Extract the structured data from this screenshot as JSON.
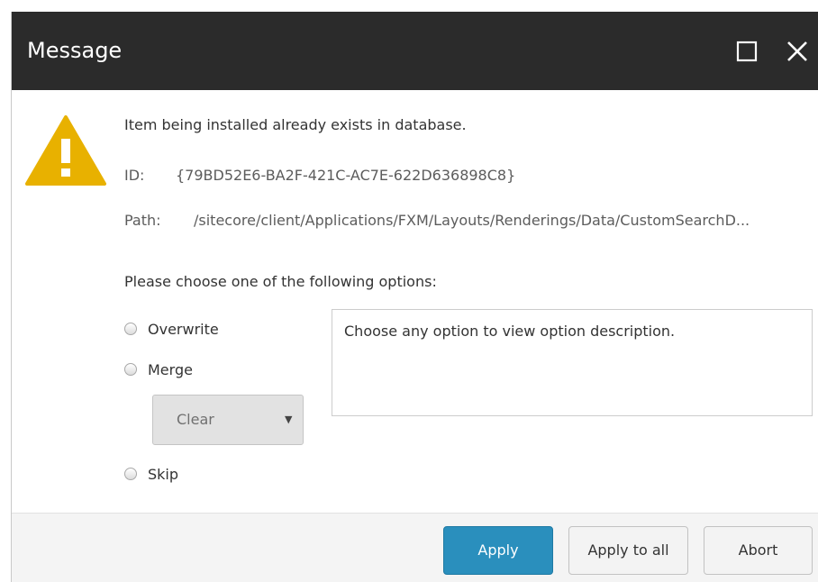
{
  "dialog": {
    "title": "Message"
  },
  "message": {
    "text": "Item being installed already exists in database.",
    "id_label": "ID:",
    "id_value": "{79BD52E6-BA2F-421C-AC7E-622D636898C8}",
    "path_label": "Path:",
    "path_value": "/sitecore/client/Applications/FXM/Layouts/Renderings/Data/CustomSearchD..."
  },
  "options": {
    "prompt": "Please choose one of the following options:",
    "overwrite_label": "Overwrite",
    "merge_label": "Merge",
    "skip_label": "Skip",
    "merge_mode_value": "Clear",
    "description": "Choose any option to view option description."
  },
  "footer": {
    "apply_label": "Apply",
    "apply_all_label": "Apply to all",
    "abort_label": "Abort"
  },
  "icons": {
    "warning": "warning-icon",
    "maximize": "maximize-icon",
    "close": "close-icon",
    "dropdown": "chevron-down-icon"
  },
  "colors": {
    "titlebar": "#2b2b2b",
    "warning": "#e8b100",
    "primary_button": "#2a8fbd"
  }
}
